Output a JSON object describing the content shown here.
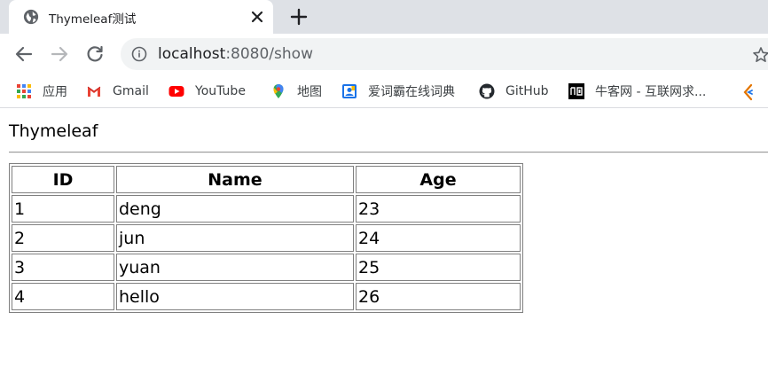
{
  "browser": {
    "tab": {
      "title": "Thymeleaf测试"
    },
    "address_bar": {
      "host": "localhost",
      "rest": ":8080/show"
    },
    "bookmarks": [
      {
        "label": "应用",
        "icon": "apps-grid-icon"
      },
      {
        "label": "Gmail",
        "icon": "gmail-icon"
      },
      {
        "label": "YouTube",
        "icon": "youtube-icon"
      },
      {
        "label": "地图",
        "icon": "maps-pin-icon"
      },
      {
        "label": "爱词霸在线词典",
        "icon": "iciba-icon"
      },
      {
        "label": "GitHub",
        "icon": "github-icon"
      },
      {
        "label": "牛客网 - 互联网求...",
        "icon": "nowcoder-icon"
      }
    ]
  },
  "page": {
    "heading": "Thymeleaf",
    "table": {
      "headers": [
        "ID",
        "Name",
        "Age"
      ],
      "rows": [
        [
          "1",
          "deng",
          "23"
        ],
        [
          "2",
          "jun",
          "24"
        ],
        [
          "3",
          "yuan",
          "25"
        ],
        [
          "4",
          "hello",
          "26"
        ]
      ]
    }
  },
  "colors": {
    "tabstrip_bg": "#dee1e6",
    "omnibox_bg": "#f1f3f4",
    "table_border": "#808080"
  }
}
